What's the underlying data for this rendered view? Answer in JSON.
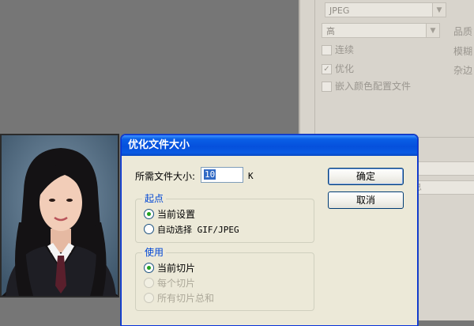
{
  "settings_panel": {
    "format_value": "JPEG",
    "quality_value": "高",
    "quality_label": "品质",
    "progressive_label": "连续",
    "blur_label": "模糊",
    "optimized_label": "优化",
    "matte_label": "杂边",
    "embed_profile_label": "嵌入颜色配置文件",
    "strip_text": "息"
  },
  "dialog": {
    "title": "优化文件大小",
    "target_size_label": "所需文件大小:",
    "target_size_value": "10",
    "target_size_unit": "K",
    "ok_label": "确定",
    "cancel_label": "取消",
    "start_group": {
      "legend": "起点",
      "options": [
        "当前设置",
        "自动选择 GIF/JPEG"
      ],
      "selected": 0
    },
    "use_group": {
      "legend": "使用",
      "options": [
        "当前切片",
        "每个切片",
        "所有切片总和"
      ],
      "selected": 0
    }
  },
  "colors": {
    "titlebar": "#0550dc",
    "dialog_bg": "#ece9d8",
    "workspace": "#767676",
    "legend_text": "#0046d5"
  }
}
